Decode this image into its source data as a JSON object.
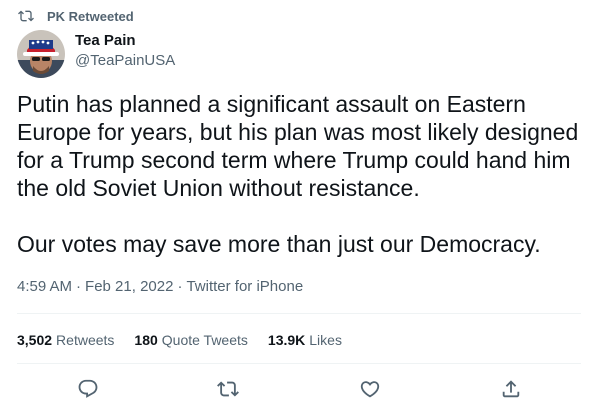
{
  "retweet_banner": {
    "label": "PK Retweeted",
    "icon": "retweet-icon"
  },
  "author": {
    "display_name": "Tea Pain",
    "handle": "@TeaPainUSA",
    "avatar_icon": "avatar"
  },
  "tweet": {
    "text": "Putin has planned a significant assault on Eastern Europe for years, but his plan was most likely designed for a Trump second term where Trump could hand him the old Soviet Union without resistance.\n\nOur votes may save more than just our Democracy.",
    "time": "4:59 AM",
    "date": "Feb 21, 2022",
    "source": "Twitter for iPhone",
    "separator": "·"
  },
  "stats": {
    "retweets": {
      "count": "3,502",
      "label": "Retweets"
    },
    "quotes": {
      "count": "180",
      "label": "Quote Tweets"
    },
    "likes": {
      "count": "13.9K",
      "label": "Likes"
    }
  },
  "actions": {
    "reply_icon": "reply-icon",
    "retweet_icon": "retweet-icon",
    "like_icon": "heart-icon",
    "share_icon": "share-icon",
    "icon_color": "#536471"
  }
}
